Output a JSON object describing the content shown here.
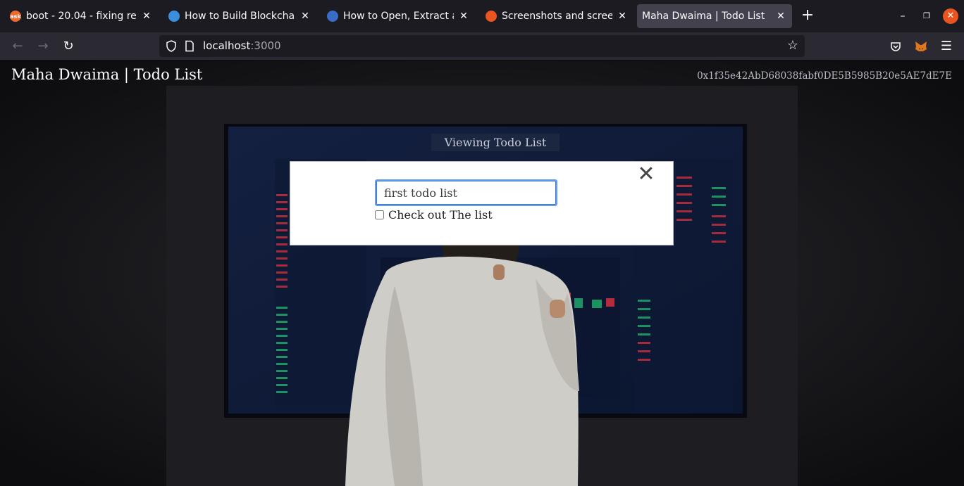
{
  "browser": {
    "tabs": [
      {
        "label": "boot - 20.04 - fixing recur",
        "favicon": "askubuntu-icon",
        "favicon_color": "#f06a2a",
        "active": false
      },
      {
        "label": "How to Build Blockchain A",
        "favicon": "blockchain-site-icon",
        "favicon_color": "#3b8ede",
        "active": false
      },
      {
        "label": "How to Open, Extract and",
        "favicon": "site-icon",
        "favicon_color": "#3a6bc7",
        "active": false
      },
      {
        "label": "Screenshots and screenca",
        "favicon": "ubuntu-icon",
        "favicon_color": "#e95420",
        "active": false
      },
      {
        "label": "Maha Dwaima | Todo List",
        "favicon": "",
        "favicon_color": "",
        "active": true
      }
    ],
    "url": {
      "host": "localhost",
      "port": ":3000"
    }
  },
  "app": {
    "title": "Maha Dwaima | Todo List",
    "account": "0x1f35e42AbD68038fabf0DE5B5985B20e5AE7dE7E",
    "section_title": "Viewing Todo List"
  },
  "modal": {
    "input_value": "first todo list",
    "checkbox_label": "Check out The list",
    "checkbox_checked": false,
    "close_symbol": "✕"
  }
}
